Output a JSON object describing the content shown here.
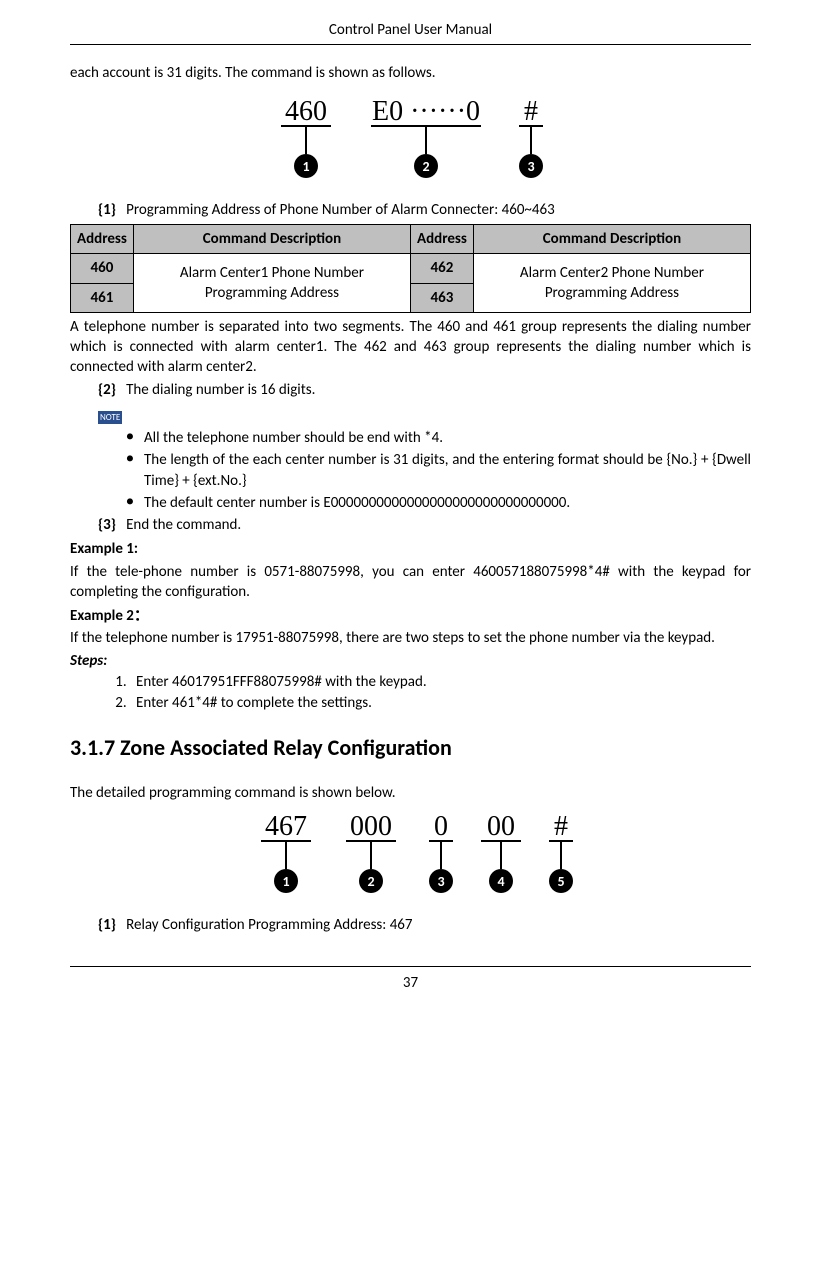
{
  "header": {
    "title": "Control Panel User Manual"
  },
  "intro": "each account is 31 digits. The command is shown as follows.",
  "diagram1": {
    "seg1": "460",
    "seg2": "E0 ······0",
    "seg3": "#",
    "n1": "1",
    "n2": "2",
    "n3": "3"
  },
  "b1": {
    "label": "{1}",
    "text": "Programming Address of Phone Number of Alarm Connecter: 460~463"
  },
  "table": {
    "h1": "Address",
    "h2": "Command Description",
    "h3": "Address",
    "h4": "Command Description",
    "r1c1": "460",
    "r1c2": "Alarm Center1 Phone Number Programming Address",
    "r1c3": "462",
    "r1c4": "Alarm Center2 Phone Number Programming Address",
    "r2c1": "461",
    "r2c3": "463"
  },
  "para1": "A telephone number is separated into two segments. The 460 and 461 group represents the dialing number which is connected with alarm center1.    The 462 and 463 group represents the dialing number which is connected with alarm center2.",
  "b2": {
    "label": "{2}",
    "text": "The dialing number is 16 digits."
  },
  "note_label": "NOTE",
  "bullets": {
    "a": "All the telephone number should be end with *4.",
    "b": "The length of the each center number is 31 digits, and the entering format should be {No.} + {Dwell Time} + {ext.No.}",
    "c": "The default center number is E0000000000000000000000000000000."
  },
  "b3": {
    "label": "{3}",
    "text": "End the command."
  },
  "ex1": {
    "title": "Example 1:",
    "body": "If the tele-phone number is 0571-88075998, you can enter 460057188075998*4# with the keypad for completing the configuration."
  },
  "ex2": {
    "title": "Example 2：",
    "body": "If the telephone number is 17951-88075998, there are two steps to set the phone number via the keypad."
  },
  "steps": {
    "title": "Steps:",
    "s1": "Enter 46017951FFF88075998# with the keypad.",
    "s2": "Enter 461*4# to complete the settings."
  },
  "section317": "3.1.7    Zone Associated Relay Configuration",
  "detail_intro": "The detailed programming command is shown below.",
  "diagram2": {
    "seg1": "467",
    "seg2": "000",
    "seg3": "0",
    "seg4": "00",
    "seg5": "#",
    "n1": "1",
    "n2": "2",
    "n3": "3",
    "n4": "4",
    "n5": "5"
  },
  "b1b": {
    "label": "{1}",
    "text": "Relay Configuration Programming Address: 467"
  },
  "page": "37"
}
